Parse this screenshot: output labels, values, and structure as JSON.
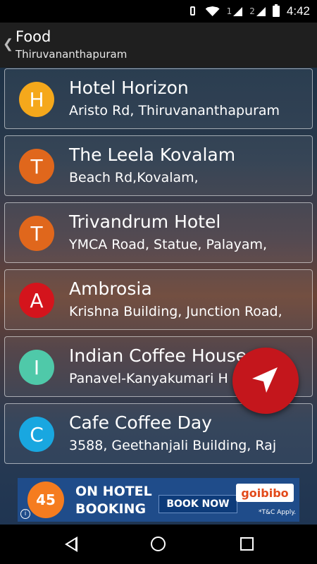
{
  "status_bar": {
    "time": "4:42",
    "sim1": "1",
    "sim2": "2"
  },
  "appbar": {
    "title": "Food",
    "subtitle": "Thiruvananthapuram"
  },
  "places": [
    {
      "initial": "H",
      "name": "Hotel Horizon",
      "address": "Aristo Rd, Thiruvananthapuram",
      "color": "#f5a81b"
    },
    {
      "initial": "T",
      "name": "The Leela Kovalam",
      "address": "Beach Rd,Kovalam,",
      "color": "#e0671c"
    },
    {
      "initial": "T",
      "name": "Trivandrum Hotel",
      "address": "YMCA Road, Statue, Palayam,",
      "color": "#e0671c"
    },
    {
      "initial": "A",
      "name": "Ambrosia",
      "address": "Krishna Building, Junction Road,",
      "color": "#d4141c"
    },
    {
      "initial": "I",
      "name": "Indian Coffee House",
      "address": "Panavel-Kanyakumari H",
      "color": "#4fc9a9"
    },
    {
      "initial": "C",
      "name": "Cafe Coffee Day",
      "address": "3588, Geethanjali Building, Raj",
      "color": "#19a7e0"
    }
  ],
  "ad": {
    "badge": "45",
    "line1": "ON HOTEL",
    "line2": "BOOKING",
    "cta": "BOOK NOW",
    "brand": "goibibo",
    "tc": "*T&C Apply."
  }
}
